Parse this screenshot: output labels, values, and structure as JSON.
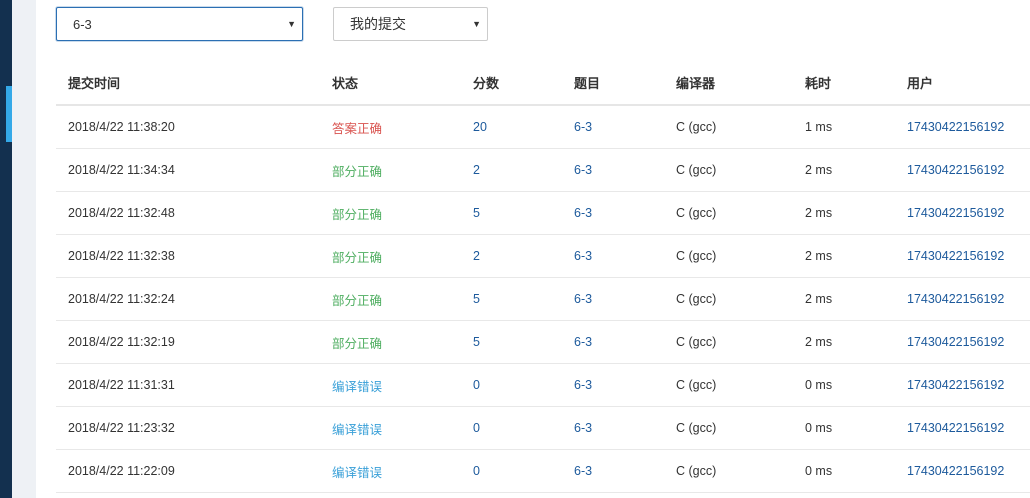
{
  "filters": {
    "problem_select": "6-3",
    "submission_select": "我的提交"
  },
  "table": {
    "headers": {
      "submit_time": "提交时间",
      "status": "状态",
      "score": "分数",
      "problem": "题目",
      "compiler": "编译器",
      "time_cost": "耗时",
      "user": "用户"
    },
    "rows": [
      {
        "submit_time": "2018/4/22 11:38:20",
        "status": "答案正确",
        "status_type": "ac",
        "score": "20",
        "problem": "6-3",
        "compiler": "C (gcc)",
        "time_cost": "1 ms",
        "user": "17430422156192"
      },
      {
        "submit_time": "2018/4/22 11:34:34",
        "status": "部分正确",
        "status_type": "pa",
        "score": "2",
        "problem": "6-3",
        "compiler": "C (gcc)",
        "time_cost": "2 ms",
        "user": "17430422156192"
      },
      {
        "submit_time": "2018/4/22 11:32:48",
        "status": "部分正确",
        "status_type": "pa",
        "score": "5",
        "problem": "6-3",
        "compiler": "C (gcc)",
        "time_cost": "2 ms",
        "user": "17430422156192"
      },
      {
        "submit_time": "2018/4/22 11:32:38",
        "status": "部分正确",
        "status_type": "pa",
        "score": "2",
        "problem": "6-3",
        "compiler": "C (gcc)",
        "time_cost": "2 ms",
        "user": "17430422156192"
      },
      {
        "submit_time": "2018/4/22 11:32:24",
        "status": "部分正确",
        "status_type": "pa",
        "score": "5",
        "problem": "6-3",
        "compiler": "C (gcc)",
        "time_cost": "2 ms",
        "user": "17430422156192"
      },
      {
        "submit_time": "2018/4/22 11:32:19",
        "status": "部分正确",
        "status_type": "pa",
        "score": "5",
        "problem": "6-3",
        "compiler": "C (gcc)",
        "time_cost": "2 ms",
        "user": "17430422156192"
      },
      {
        "submit_time": "2018/4/22 11:31:31",
        "status": "编译错误",
        "status_type": "ce",
        "score": "0",
        "problem": "6-3",
        "compiler": "C (gcc)",
        "time_cost": "0 ms",
        "user": "17430422156192"
      },
      {
        "submit_time": "2018/4/22 11:23:32",
        "status": "编译错误",
        "status_type": "ce",
        "score": "0",
        "problem": "6-3",
        "compiler": "C (gcc)",
        "time_cost": "0 ms",
        "user": "17430422156192"
      },
      {
        "submit_time": "2018/4/22 11:22:09",
        "status": "编译错误",
        "status_type": "ce",
        "score": "0",
        "problem": "6-3",
        "compiler": "C (gcc)",
        "time_cost": "0 ms",
        "user": "17430422156192"
      }
    ]
  },
  "colors": {
    "sidebar": "#13304f",
    "sidebar_indicator": "#34a9e8",
    "status_accepted": "#d9534f",
    "status_partial": "#4fae61",
    "status_compile_error": "#3aa0d8",
    "link": "#1d5a9c"
  }
}
